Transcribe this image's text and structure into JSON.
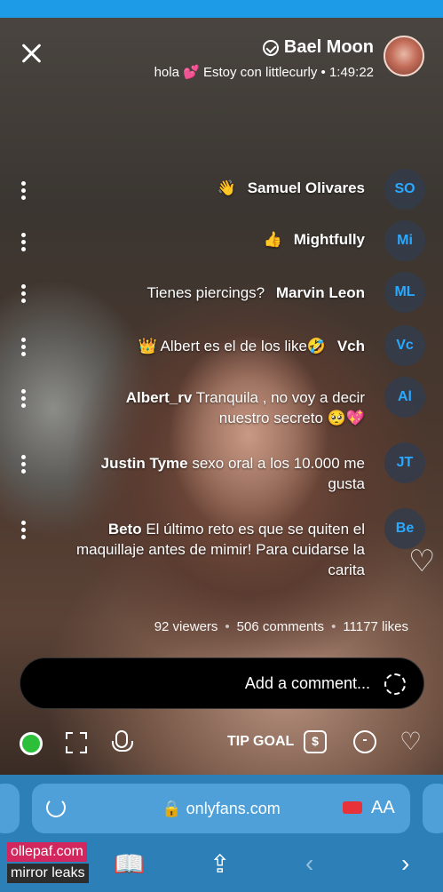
{
  "stream": {
    "creator_name": "Bael Moon",
    "status_time": "1:49:22",
    "status_text": "Estoy con littlecurly",
    "status_heart": "💕",
    "status_tail": "hola"
  },
  "comments": [
    {
      "initials": "SO",
      "user": "Samuel Olivares",
      "text": "👋"
    },
    {
      "initials": "Mi",
      "user": "Mightfully",
      "text": "👍"
    },
    {
      "initials": "ML",
      "user": "Marvin Leon",
      "text": "Tienes piercings?"
    },
    {
      "initials": "Vc",
      "user": "Vch",
      "text": "👑 Albert es el de los like🤣"
    },
    {
      "initials": "Al",
      "user": "Albert_rv",
      "text": "Tranquila , no voy a decir nuestro secreto 🥺💖"
    },
    {
      "initials": "JT",
      "user": "Justin Tyme",
      "text": "sexo oral a los 10.000 me gusta"
    },
    {
      "initials": "Be",
      "user": "Beto",
      "text": "El último reto es que se quiten el maquillaje antes de mimir! Para cuidarse la carita"
    }
  ],
  "stats": {
    "likes": "11177 likes",
    "comments": "506 comments",
    "viewers": "92 viewers"
  },
  "comment_box": {
    "placeholder": "Add a comment..."
  },
  "toolbar": {
    "tip_goal_label": "TIP GOAL"
  },
  "browser": {
    "url": "onlyfans.com",
    "aa_label": "AA"
  },
  "watermark": {
    "line1": "ollepaf.com",
    "line2": "mirror leaks"
  },
  "colors": {
    "accent": "#2aa9ff",
    "browser_bar": "#2d7fb8",
    "live_green": "#2bbf3a"
  }
}
